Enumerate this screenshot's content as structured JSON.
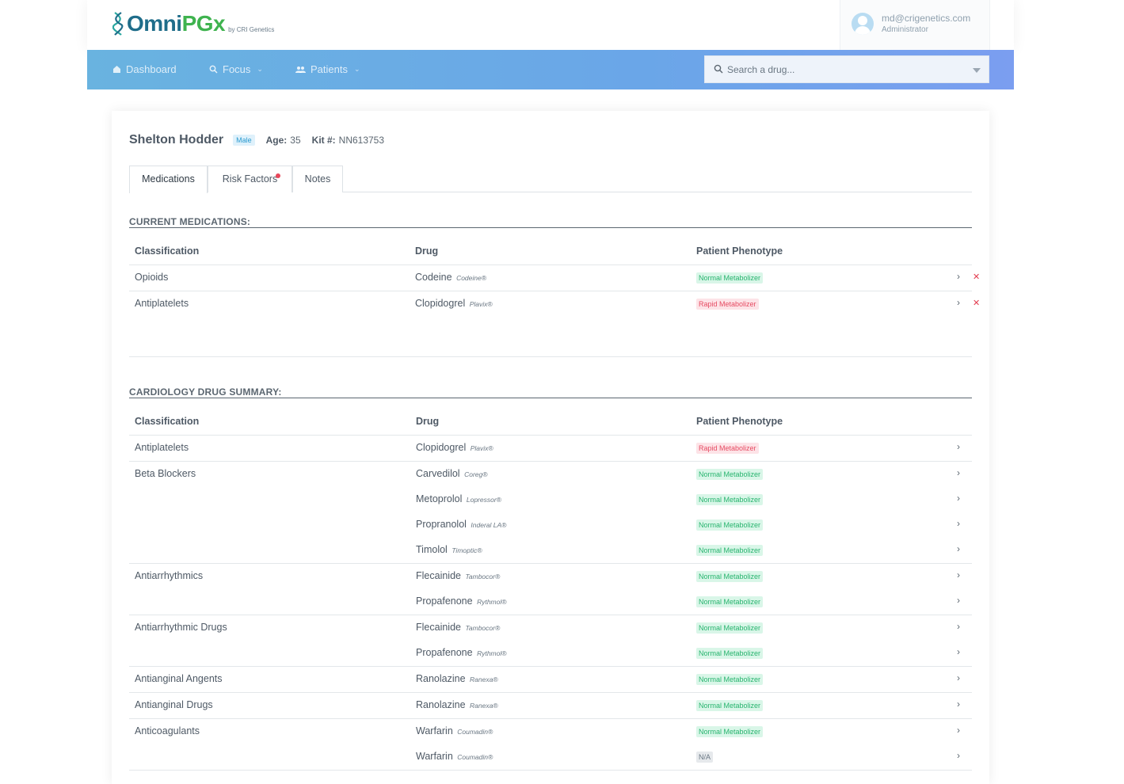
{
  "app": {
    "logo_omni": "Omni",
    "logo_pgx": "PGx",
    "logo_by": "by CRI Genetics"
  },
  "user": {
    "email": "md@crigenetics.com",
    "role": "Administrator"
  },
  "nav": {
    "dashboard": "Dashboard",
    "focus": "Focus",
    "patients": "Patients",
    "search_placeholder": "Search a drug..."
  },
  "patient": {
    "name": "Shelton Hodder",
    "sex": "Male",
    "age_label": "Age:",
    "age": "35",
    "kit_label": "Kit #:",
    "kit": "NN613753"
  },
  "tabs": [
    {
      "label": "Medications",
      "active": true
    },
    {
      "label": "Risk Factors",
      "alert": true
    },
    {
      "label": "Notes"
    }
  ],
  "columns": {
    "classification": "Classification",
    "drug": "Drug",
    "phenotype": "Patient Phenotype"
  },
  "current_medications": {
    "title": "CURRENT MEDICATIONS:",
    "rows": [
      {
        "classification": "Opioids",
        "drug": "Codeine",
        "brand": "Codeine®",
        "phenotype": "Normal Metabolizer",
        "status": "normal"
      },
      {
        "classification": "Antiplatelets",
        "drug": "Clopidogrel",
        "brand": "Plavix®",
        "phenotype": "Rapid Metabolizer",
        "status": "rapid"
      }
    ]
  },
  "cardiology_summary": {
    "title": "CARDIOLOGY DRUG SUMMARY:",
    "rows": [
      {
        "classification": "Antiplatelets",
        "drug": "Clopidogrel",
        "brand": "Plavix®",
        "phenotype": "Rapid Metabolizer",
        "status": "rapid"
      },
      {
        "classification": "Beta Blockers",
        "drug": "Carvedilol",
        "brand": "Coreg®",
        "phenotype": "Normal Metabolizer",
        "status": "normal"
      },
      {
        "classification": "",
        "drug": "Metoprolol",
        "brand": "Lopressor®",
        "phenotype": "Normal Metabolizer",
        "status": "normal"
      },
      {
        "classification": "",
        "drug": "Propranolol",
        "brand": "Inderal LA®",
        "phenotype": "Normal Metabolizer",
        "status": "normal"
      },
      {
        "classification": "",
        "drug": "Timolol",
        "brand": "Timoptic®",
        "phenotype": "Normal Metabolizer",
        "status": "normal"
      },
      {
        "classification": "Antiarrhythmics",
        "drug": "Flecainide",
        "brand": "Tambocor®",
        "phenotype": "Normal Metabolizer",
        "status": "normal"
      },
      {
        "classification": "",
        "drug": "Propafenone",
        "brand": "Rythmol®",
        "phenotype": "Normal Metabolizer",
        "status": "normal"
      },
      {
        "classification": "Antiarrhythmic Drugs",
        "drug": "Flecainide",
        "brand": "Tambocor®",
        "phenotype": "Normal Metabolizer",
        "status": "normal"
      },
      {
        "classification": "",
        "drug": "Propafenone",
        "brand": "Rythmol®",
        "phenotype": "Normal Metabolizer",
        "status": "normal"
      },
      {
        "classification": "Antianginal Angents",
        "drug": "Ranolazine",
        "brand": "Ranexa®",
        "phenotype": "Normal Metabolizer",
        "status": "normal"
      },
      {
        "classification": "Antianginal Drugs",
        "drug": "Ranolazine",
        "brand": "Ranexa®",
        "phenotype": "Normal Metabolizer",
        "status": "normal"
      },
      {
        "classification": "Anticoagulants",
        "drug": "Warfarin",
        "brand": "Coumadin®",
        "phenotype": "Normal Metabolizer",
        "status": "normal"
      },
      {
        "classification": "",
        "drug": "Warfarin",
        "brand": "Coumadin®",
        "phenotype": "N/A",
        "status": "na"
      }
    ]
  },
  "icons": {
    "row_open": "chevron-right-icon",
    "row_remove": "close-icon",
    "search": "search-icon",
    "dashboard": "home-icon",
    "focus": "search-icon",
    "patients": "users-icon"
  },
  "colors": {
    "nav_gradient_start": "#69b3e0",
    "nav_gradient_end": "#7b9ef0",
    "normal": "#27b46e",
    "rapid": "#e64b62",
    "alert_dot": "#e8475a"
  }
}
